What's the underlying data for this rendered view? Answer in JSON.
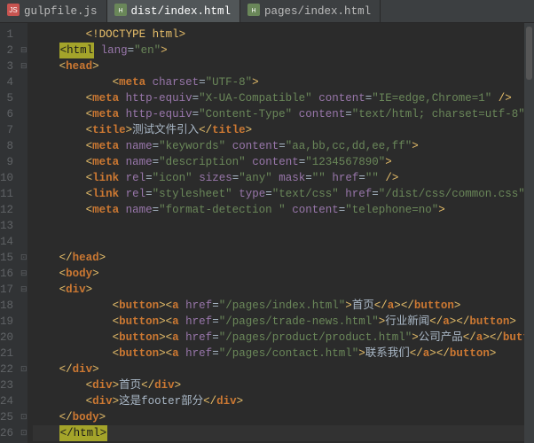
{
  "tabs": [
    {
      "label": "gulpfile.js",
      "icon": "js",
      "active": false
    },
    {
      "label": "dist/index.html",
      "icon": "html",
      "active": true
    },
    {
      "label": "pages/index.html",
      "icon": "html",
      "active": false
    }
  ],
  "lines_total": 26,
  "active_line": 26,
  "highlight": {
    "open_line": 2,
    "open_text": "<html",
    "close_line": 26,
    "close_text": "</html>"
  },
  "code_lines": [
    {
      "n": 1,
      "indent": 2,
      "fold": "",
      "tokens": [
        [
          "tagp",
          "<!"
        ],
        [
          "doct",
          "DOCTYPE html"
        ],
        [
          "tagp",
          ">"
        ]
      ]
    },
    {
      "n": 2,
      "indent": 1,
      "fold": "open",
      "tokens": [
        [
          "hl-open",
          "<html"
        ],
        [
          "txt",
          " "
        ],
        [
          "attr",
          "lang"
        ],
        [
          "eq",
          "="
        ],
        [
          "str",
          "\"en\""
        ],
        [
          "tagp",
          ">"
        ]
      ]
    },
    {
      "n": 3,
      "indent": 1,
      "fold": "open",
      "tokens": [
        [
          "tagp",
          "<"
        ],
        [
          "tag",
          "head"
        ],
        [
          "tagp",
          ">"
        ]
      ]
    },
    {
      "n": 4,
      "indent": 3,
      "fold": "",
      "tokens": [
        [
          "tagp",
          "<"
        ],
        [
          "tag",
          "meta"
        ],
        [
          "txt",
          " "
        ],
        [
          "attr",
          "charset"
        ],
        [
          "eq",
          "="
        ],
        [
          "str",
          "\"UTF-8\""
        ],
        [
          "tagp",
          ">"
        ]
      ]
    },
    {
      "n": 5,
      "indent": 2,
      "fold": "",
      "tokens": [
        [
          "tagp",
          "<"
        ],
        [
          "tag",
          "meta"
        ],
        [
          "txt",
          " "
        ],
        [
          "attr",
          "http-equiv"
        ],
        [
          "eq",
          "="
        ],
        [
          "str",
          "\"X-UA-Compatible\""
        ],
        [
          "txt",
          " "
        ],
        [
          "attr",
          "content"
        ],
        [
          "eq",
          "="
        ],
        [
          "str",
          "\"IE=edge,Chrome=1\""
        ],
        [
          "txt",
          " "
        ],
        [
          "tagp",
          "/>"
        ]
      ]
    },
    {
      "n": 6,
      "indent": 2,
      "fold": "",
      "tokens": [
        [
          "tagp",
          "<"
        ],
        [
          "tag",
          "meta"
        ],
        [
          "txt",
          " "
        ],
        [
          "attr",
          "http-equiv"
        ],
        [
          "eq",
          "="
        ],
        [
          "str",
          "\"Content-Type\""
        ],
        [
          "txt",
          " "
        ],
        [
          "attr",
          "content"
        ],
        [
          "eq",
          "="
        ],
        [
          "str",
          "\"text/html; charset=utf-8\""
        ],
        [
          "txt",
          " "
        ],
        [
          "tagp",
          "/>"
        ]
      ]
    },
    {
      "n": 7,
      "indent": 2,
      "fold": "",
      "tokens": [
        [
          "tagp",
          "<"
        ],
        [
          "tag",
          "title"
        ],
        [
          "tagp",
          ">"
        ],
        [
          "txt",
          "测试文件引入"
        ],
        [
          "tagp",
          "</"
        ],
        [
          "tag",
          "title"
        ],
        [
          "tagp",
          ">"
        ]
      ]
    },
    {
      "n": 8,
      "indent": 2,
      "fold": "",
      "tokens": [
        [
          "tagp",
          "<"
        ],
        [
          "tag",
          "meta"
        ],
        [
          "txt",
          " "
        ],
        [
          "attr",
          "name"
        ],
        [
          "eq",
          "="
        ],
        [
          "str",
          "\"keywords\""
        ],
        [
          "txt",
          " "
        ],
        [
          "attr",
          "content"
        ],
        [
          "eq",
          "="
        ],
        [
          "str",
          "\"aa,bb,cc,dd,ee,ff\""
        ],
        [
          "tagp",
          ">"
        ]
      ]
    },
    {
      "n": 9,
      "indent": 2,
      "fold": "",
      "tokens": [
        [
          "tagp",
          "<"
        ],
        [
          "tag",
          "meta"
        ],
        [
          "txt",
          " "
        ],
        [
          "attr",
          "name"
        ],
        [
          "eq",
          "="
        ],
        [
          "str",
          "\"description\""
        ],
        [
          "txt",
          " "
        ],
        [
          "attr",
          "content"
        ],
        [
          "eq",
          "="
        ],
        [
          "str",
          "\"1234567890\""
        ],
        [
          "tagp",
          ">"
        ]
      ]
    },
    {
      "n": 10,
      "indent": 2,
      "fold": "",
      "tokens": [
        [
          "tagp",
          "<"
        ],
        [
          "tag",
          "link"
        ],
        [
          "txt",
          " "
        ],
        [
          "attr",
          "rel"
        ],
        [
          "eq",
          "="
        ],
        [
          "str",
          "\"icon\""
        ],
        [
          "txt",
          " "
        ],
        [
          "attr",
          "sizes"
        ],
        [
          "eq",
          "="
        ],
        [
          "str",
          "\"any\""
        ],
        [
          "txt",
          " "
        ],
        [
          "attr",
          "mask"
        ],
        [
          "eq",
          "="
        ],
        [
          "str",
          "\"\""
        ],
        [
          "txt",
          " "
        ],
        [
          "attr",
          "href"
        ],
        [
          "eq",
          "="
        ],
        [
          "str",
          "\"\""
        ],
        [
          "txt",
          " "
        ],
        [
          "tagp",
          "/>"
        ]
      ]
    },
    {
      "n": 11,
      "indent": 2,
      "fold": "",
      "tokens": [
        [
          "tagp",
          "<"
        ],
        [
          "tag",
          "link"
        ],
        [
          "txt",
          " "
        ],
        [
          "attr",
          "rel"
        ],
        [
          "eq",
          "="
        ],
        [
          "str",
          "\"stylesheet\""
        ],
        [
          "txt",
          " "
        ],
        [
          "attr",
          "type"
        ],
        [
          "eq",
          "="
        ],
        [
          "str",
          "\"text/css\""
        ],
        [
          "txt",
          " "
        ],
        [
          "attr",
          "href"
        ],
        [
          "eq",
          "="
        ],
        [
          "str",
          "\"/dist/css/common.css\""
        ],
        [
          "txt",
          " "
        ],
        [
          "tagp",
          "/>"
        ]
      ]
    },
    {
      "n": 12,
      "indent": 2,
      "fold": "",
      "tokens": [
        [
          "tagp",
          "<"
        ],
        [
          "tag",
          "meta"
        ],
        [
          "txt",
          " "
        ],
        [
          "attr",
          "name"
        ],
        [
          "eq",
          "="
        ],
        [
          "str",
          "\"format-detection \""
        ],
        [
          "txt",
          " "
        ],
        [
          "attr",
          "content"
        ],
        [
          "eq",
          "="
        ],
        [
          "str",
          "\"telephone=no\""
        ],
        [
          "tagp",
          ">"
        ]
      ]
    },
    {
      "n": 13,
      "indent": 0,
      "fold": "",
      "tokens": []
    },
    {
      "n": 14,
      "indent": 0,
      "fold": "",
      "tokens": []
    },
    {
      "n": 15,
      "indent": 1,
      "fold": "close",
      "tokens": [
        [
          "tagp",
          "</"
        ],
        [
          "tag",
          "head"
        ],
        [
          "tagp",
          ">"
        ]
      ]
    },
    {
      "n": 16,
      "indent": 1,
      "fold": "open",
      "tokens": [
        [
          "tagp",
          "<"
        ],
        [
          "tag",
          "body"
        ],
        [
          "tagp",
          ">"
        ]
      ]
    },
    {
      "n": 17,
      "indent": 1,
      "fold": "open",
      "tokens": [
        [
          "tagp",
          "<"
        ],
        [
          "tag",
          "div"
        ],
        [
          "tagp",
          ">"
        ]
      ]
    },
    {
      "n": 18,
      "indent": 3,
      "fold": "",
      "tokens": [
        [
          "tagp",
          "<"
        ],
        [
          "tag",
          "button"
        ],
        [
          "tagp",
          ">"
        ],
        [
          "tagp",
          "<"
        ],
        [
          "tag",
          "a"
        ],
        [
          "txt",
          " "
        ],
        [
          "attr",
          "href"
        ],
        [
          "eq",
          "="
        ],
        [
          "str",
          "\"/pages/index.html\""
        ],
        [
          "tagp",
          ">"
        ],
        [
          "txt",
          "首页"
        ],
        [
          "tagp",
          "</"
        ],
        [
          "tag",
          "a"
        ],
        [
          "tagp",
          ">"
        ],
        [
          "tagp",
          "</"
        ],
        [
          "tag",
          "button"
        ],
        [
          "tagp",
          ">"
        ]
      ]
    },
    {
      "n": 19,
      "indent": 3,
      "fold": "",
      "tokens": [
        [
          "tagp",
          "<"
        ],
        [
          "tag",
          "button"
        ],
        [
          "tagp",
          ">"
        ],
        [
          "tagp",
          "<"
        ],
        [
          "tag",
          "a"
        ],
        [
          "txt",
          " "
        ],
        [
          "attr",
          "href"
        ],
        [
          "eq",
          "="
        ],
        [
          "str",
          "\"/pages/trade-news.html\""
        ],
        [
          "tagp",
          ">"
        ],
        [
          "txt",
          "行业新闻"
        ],
        [
          "tagp",
          "</"
        ],
        [
          "tag",
          "a"
        ],
        [
          "tagp",
          ">"
        ],
        [
          "tagp",
          "</"
        ],
        [
          "tag",
          "button"
        ],
        [
          "tagp",
          ">"
        ]
      ]
    },
    {
      "n": 20,
      "indent": 3,
      "fold": "",
      "tokens": [
        [
          "tagp",
          "<"
        ],
        [
          "tag",
          "button"
        ],
        [
          "tagp",
          ">"
        ],
        [
          "tagp",
          "<"
        ],
        [
          "tag",
          "a"
        ],
        [
          "txt",
          " "
        ],
        [
          "attr",
          "href"
        ],
        [
          "eq",
          "="
        ],
        [
          "str",
          "\"/pages/product/product.html\""
        ],
        [
          "tagp",
          ">"
        ],
        [
          "txt",
          "公司产品"
        ],
        [
          "tagp",
          "</"
        ],
        [
          "tag",
          "a"
        ],
        [
          "tagp",
          ">"
        ],
        [
          "tagp",
          "</"
        ],
        [
          "tag",
          "button"
        ],
        [
          "tagp",
          ">"
        ]
      ]
    },
    {
      "n": 21,
      "indent": 3,
      "fold": "",
      "tokens": [
        [
          "tagp",
          "<"
        ],
        [
          "tag",
          "button"
        ],
        [
          "tagp",
          ">"
        ],
        [
          "tagp",
          "<"
        ],
        [
          "tag",
          "a"
        ],
        [
          "txt",
          " "
        ],
        [
          "attr",
          "href"
        ],
        [
          "eq",
          "="
        ],
        [
          "str",
          "\"/pages/contact.html\""
        ],
        [
          "tagp",
          ">"
        ],
        [
          "txt",
          "联系我们"
        ],
        [
          "tagp",
          "</"
        ],
        [
          "tag",
          "a"
        ],
        [
          "tagp",
          ">"
        ],
        [
          "tagp",
          "</"
        ],
        [
          "tag",
          "button"
        ],
        [
          "tagp",
          ">"
        ]
      ]
    },
    {
      "n": 22,
      "indent": 1,
      "fold": "close",
      "tokens": [
        [
          "tagp",
          "</"
        ],
        [
          "tag",
          "div"
        ],
        [
          "tagp",
          ">"
        ]
      ]
    },
    {
      "n": 23,
      "indent": 2,
      "fold": "",
      "tokens": [
        [
          "tagp",
          "<"
        ],
        [
          "tag",
          "div"
        ],
        [
          "tagp",
          ">"
        ],
        [
          "txt",
          "首页"
        ],
        [
          "tagp",
          "</"
        ],
        [
          "tag",
          "div"
        ],
        [
          "tagp",
          ">"
        ]
      ]
    },
    {
      "n": 24,
      "indent": 2,
      "fold": "",
      "tokens": [
        [
          "tagp",
          "<"
        ],
        [
          "tag",
          "div"
        ],
        [
          "tagp",
          ">"
        ],
        [
          "txt",
          "这是footer部分"
        ],
        [
          "tagp",
          "</"
        ],
        [
          "tag",
          "div"
        ],
        [
          "tagp",
          ">"
        ]
      ]
    },
    {
      "n": 25,
      "indent": 1,
      "fold": "close",
      "tokens": [
        [
          "tagp",
          "</"
        ],
        [
          "tag",
          "body"
        ],
        [
          "tagp",
          ">"
        ]
      ]
    },
    {
      "n": 26,
      "indent": 1,
      "fold": "close",
      "tokens": [
        [
          "hl-close",
          "</html>"
        ]
      ]
    }
  ]
}
